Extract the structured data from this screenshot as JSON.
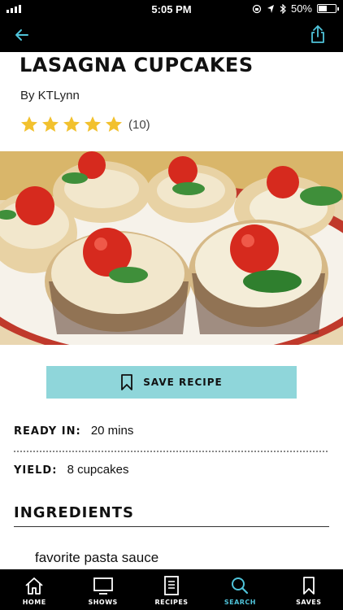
{
  "status_bar": {
    "time": "5:05 PM",
    "battery_percent": "50%",
    "battery_level": 0.5,
    "icons": [
      "signal-icon",
      "lock-rotation-icon",
      "location-icon",
      "bluetooth-icon",
      "battery-icon"
    ]
  },
  "nav": {
    "back_icon": "back-arrow-icon",
    "share_icon": "share-icon"
  },
  "recipe": {
    "title": "LASAGNA CUPCAKES",
    "author": "By KTLynn",
    "rating": 5,
    "rating_count": "(10)",
    "photo_alt_icon": "recipe-photo"
  },
  "actions": {
    "save_label": "SAVE RECIPE",
    "save_icon": "bookmark-icon",
    "accent_color": "#8fd6da"
  },
  "details": {
    "ready_label": "READY IN:",
    "ready_value": "20 mins",
    "yield_label": "YIELD:",
    "yield_value": "8 cupcakes"
  },
  "ingredients": {
    "heading": "INGREDIENTS",
    "items": [
      "favorite pasta sauce"
    ]
  },
  "tab_bar": {
    "active_color": "#4fc3d9",
    "tabs": [
      {
        "label": "HOME",
        "icon": "home-icon",
        "active": false
      },
      {
        "label": "SHOWS",
        "icon": "tv-icon",
        "active": false
      },
      {
        "label": "RECIPES",
        "icon": "recipe-book-icon",
        "active": false
      },
      {
        "label": "SEARCH",
        "icon": "search-icon",
        "active": true
      },
      {
        "label": "SAVES",
        "icon": "bookmark-icon",
        "active": false
      }
    ]
  }
}
